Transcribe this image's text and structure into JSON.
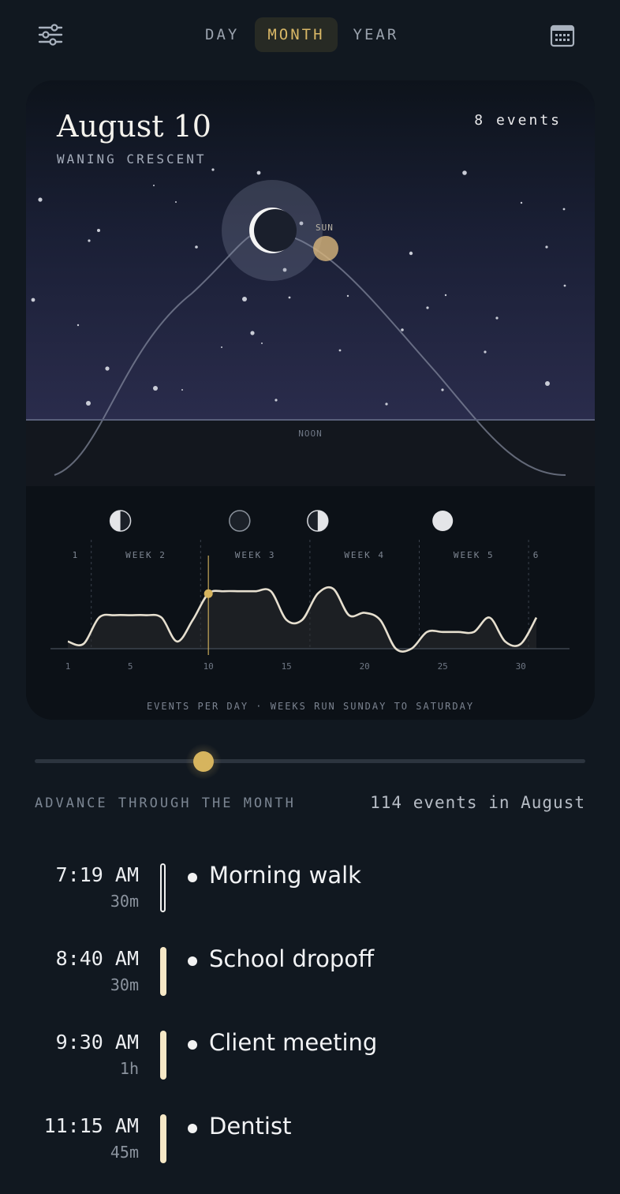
{
  "nav": {
    "tabs": [
      {
        "label": "DAY",
        "active": false
      },
      {
        "label": "MONTH",
        "active": true
      },
      {
        "label": "YEAR",
        "active": false
      }
    ],
    "left_icon": "sliders-icon",
    "right_icon": "calendar-icon"
  },
  "card": {
    "date": "August 10",
    "moon_phase": "WANING CRESCENT",
    "events_count": "8 events",
    "sun_label": "SUN",
    "noon_label": "NOON",
    "caption": "EVENTS PER DAY · WEEKS RUN SUNDAY TO SATURDAY"
  },
  "chart_data": {
    "type": "area",
    "x": [
      1,
      2,
      3,
      4,
      5,
      6,
      7,
      8,
      9,
      10,
      11,
      12,
      13,
      14,
      15,
      16,
      17,
      18,
      19,
      20,
      21,
      22,
      23,
      24,
      25,
      26,
      27,
      28,
      29,
      30,
      31
    ],
    "values": [
      0.3,
      0.2,
      1.3,
      1.4,
      1.4,
      1.4,
      1.3,
      0.3,
      1.2,
      2.3,
      2.4,
      2.4,
      2.4,
      2.4,
      1.2,
      1.2,
      2.3,
      2.5,
      1.4,
      1.5,
      1.2,
      0,
      0,
      0.7,
      0.7,
      0.7,
      0.7,
      1.3,
      0.3,
      0.2,
      1.3
    ],
    "ylim": [
      0,
      3
    ],
    "tick_labels": [
      "1",
      "5",
      "10",
      "15",
      "20",
      "25",
      "30"
    ],
    "week_labels": [
      "1",
      "WEEK 2",
      "WEEK 3",
      "WEEK 4",
      "WEEK 5",
      "6"
    ],
    "moon_phases": [
      "first-quarter",
      "new-moon",
      "last-quarter",
      "full-moon"
    ],
    "selected_day": 10,
    "accent": "#d6b45e",
    "line_color": "#e6dfcf"
  },
  "slider": {
    "label": "ADVANCE THROUGH THE MONTH",
    "total": "114 events in August",
    "day": 10,
    "days_in_month": 31
  },
  "events": [
    {
      "time": "7:19 AM",
      "duration": "30m",
      "title": "Morning walk",
      "style": "hollow"
    },
    {
      "time": "8:40 AM",
      "duration": "30m",
      "title": "School dropoff",
      "style": "filled"
    },
    {
      "time": "9:30 AM",
      "duration": "1h",
      "title": "Client meeting",
      "style": "filled"
    },
    {
      "time": "11:15 AM",
      "duration": "45m",
      "title": "Dentist",
      "style": "filled"
    }
  ]
}
